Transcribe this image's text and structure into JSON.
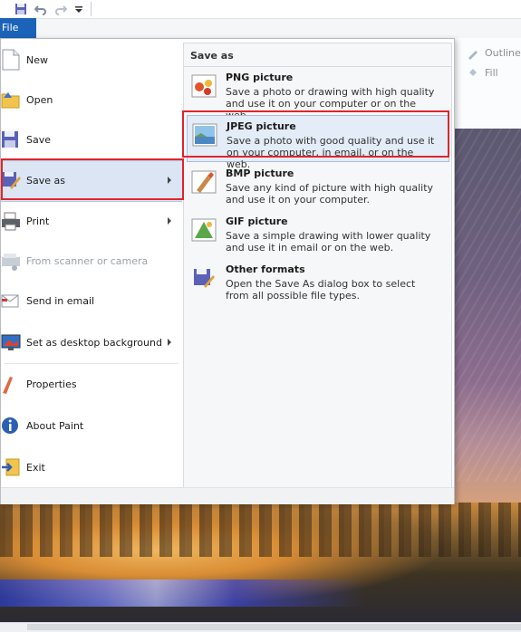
{
  "quick_access": {
    "icons": [
      "save-icon",
      "undo-icon",
      "redo-icon",
      "customize-arrow-icon"
    ]
  },
  "file_tab": {
    "label": "File"
  },
  "ribbon": {
    "outline_label": "Outline",
    "fill_label": "Fill"
  },
  "menu": {
    "items": [
      {
        "label": "New",
        "icon": "new-document-icon",
        "enabled": true,
        "submenu": false
      },
      {
        "label": "Open",
        "icon": "open-folder-icon",
        "enabled": true,
        "submenu": false
      },
      {
        "label": "Save",
        "icon": "floppy-disk-icon",
        "enabled": true,
        "submenu": false
      },
      {
        "label": "Save as",
        "icon": "save-as-icon",
        "enabled": true,
        "submenu": true,
        "selected": true
      },
      {
        "label": "Print",
        "icon": "printer-icon",
        "enabled": true,
        "submenu": true
      },
      {
        "label": "From scanner or camera",
        "icon": "scanner-icon",
        "enabled": false,
        "submenu": false
      },
      {
        "label": "Send in email",
        "icon": "email-icon",
        "enabled": true,
        "submenu": false
      },
      {
        "label": "Set as desktop background",
        "icon": "desktop-background-icon",
        "enabled": true,
        "submenu": true
      },
      {
        "label": "Properties",
        "icon": "properties-check-icon",
        "enabled": true,
        "submenu": false
      },
      {
        "label": "About Paint",
        "icon": "info-icon",
        "enabled": true,
        "submenu": false
      },
      {
        "label": "Exit",
        "icon": "exit-icon",
        "enabled": true,
        "submenu": false
      }
    ]
  },
  "save_as": {
    "title": "Save as",
    "options": [
      {
        "title": "PNG picture",
        "description": "Save a photo or drawing with high quality and use it on your computer or on the web.",
        "icon": "png-picture-icon"
      },
      {
        "title": "JPEG picture",
        "description": "Save a photo with good quality and use it on your computer, in email, or on the web.",
        "icon": "jpeg-picture-icon",
        "highlighted": true
      },
      {
        "title": "BMP picture",
        "description": "Save any kind of picture with high quality and use it on your computer.",
        "icon": "bmp-picture-icon"
      },
      {
        "title": "GIF picture",
        "description": "Save a simple drawing with lower quality and use it in email or on the web.",
        "icon": "gif-picture-icon"
      },
      {
        "title": "Other formats",
        "description": "Open the Save As dialog box to select from all possible file types.",
        "icon": "other-formats-icon"
      }
    ]
  },
  "colors": {
    "accent": "#1a63b8",
    "highlight_border": "#e0242b",
    "selected_bg": "#dbe5f3"
  }
}
